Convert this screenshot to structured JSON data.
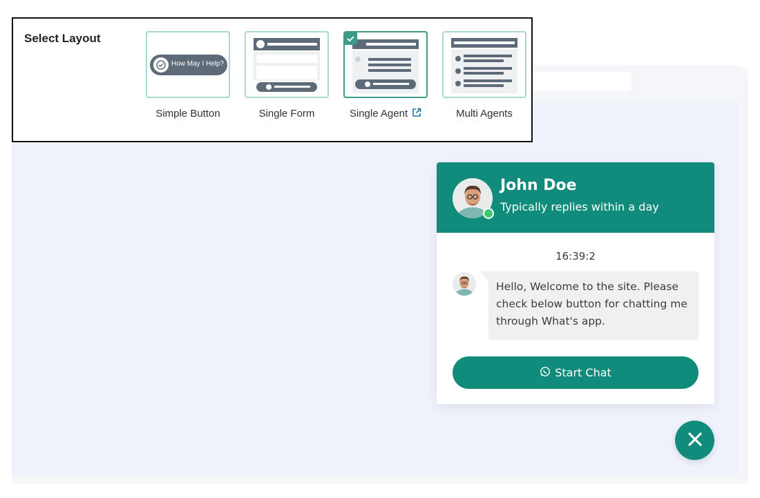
{
  "layout_selector": {
    "title": "Select Layout",
    "options": [
      {
        "label": "Simple Button",
        "preview_text": "How May I Help?",
        "selected": false
      },
      {
        "label": "Single Form",
        "selected": false
      },
      {
        "label": "Single Agent",
        "selected": true,
        "external_link_icon": "external-link-icon"
      },
      {
        "label": "Multi Agents",
        "selected": false
      }
    ]
  },
  "chat_widget": {
    "agent_name": "John Doe",
    "agent_status": "Typically replies within a day",
    "online": true,
    "time": "16:39:2",
    "message": "Hello, Welcome to the site. Please check below button for chatting me through What's app.",
    "start_button_label": "Start Chat",
    "start_button_icon": "whatsapp-icon",
    "close_icon": "close-icon"
  },
  "colors": {
    "brand": "#118c7c",
    "selected_border": "#3c9a88",
    "thumb_border": "#a9d8d1",
    "online": "#3fc66f"
  }
}
